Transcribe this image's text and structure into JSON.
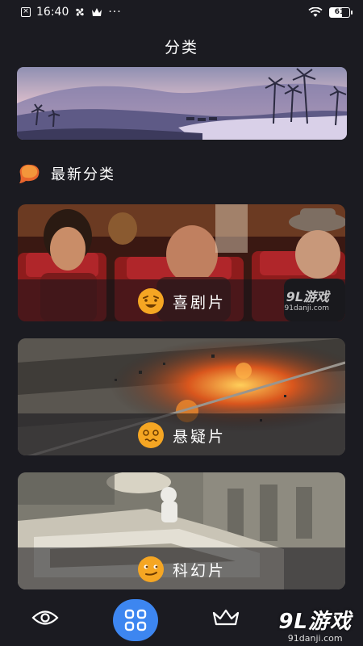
{
  "status": {
    "time": "16:40",
    "battery": "61"
  },
  "header": {
    "title": "分类"
  },
  "section": {
    "title": "最新分类"
  },
  "categories": [
    {
      "label": "喜剧片",
      "icon": "laughing-face-icon"
    },
    {
      "label": "悬疑片",
      "icon": "confused-face-icon"
    },
    {
      "label": "科幻片",
      "icon": "smirk-face-icon"
    }
  ],
  "card_watermark": {
    "brand": "9L游戏",
    "url": "91danji.com"
  },
  "watermark": {
    "brand": "9L游戏",
    "url": "91danji.com"
  },
  "tabbar": {
    "tabs": [
      {
        "icon": "eye-icon",
        "active": false
      },
      {
        "icon": "grid-icon",
        "active": true
      },
      {
        "icon": "crown-icon",
        "active": false
      }
    ]
  },
  "colors": {
    "background": "#1b1b21",
    "accent": "#3d86f0"
  }
}
